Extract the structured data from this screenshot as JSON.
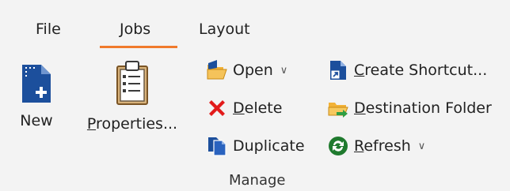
{
  "tabs": [
    {
      "label": "File"
    },
    {
      "label": "Jobs",
      "active": true
    },
    {
      "label": "Layout"
    }
  ],
  "accent_color": "#f07a2c",
  "buttons": {
    "new": {
      "label": "New",
      "icon": "new-document-icon"
    },
    "properties": {
      "mnemonic": "P",
      "rest": "roperties...",
      "icon": "clipboard-icon"
    },
    "open": {
      "label": "Open",
      "icon": "folder-open-icon"
    },
    "delete": {
      "mnemonic": "D",
      "rest": "elete",
      "icon": "delete-x-icon"
    },
    "duplicate": {
      "label": "Duplicate",
      "icon": "duplicate-icon"
    },
    "create_shortcut": {
      "mnemonic": "C",
      "rest": "reate Shortcut...",
      "icon": "shortcut-icon"
    },
    "destination_folder": {
      "mnemonic": "D",
      "rest": "estination Folder",
      "icon": "folder-arrow-icon"
    },
    "refresh": {
      "mnemonic": "R",
      "rest": "efresh",
      "icon": "refresh-icon"
    }
  },
  "group_label": "Manage"
}
